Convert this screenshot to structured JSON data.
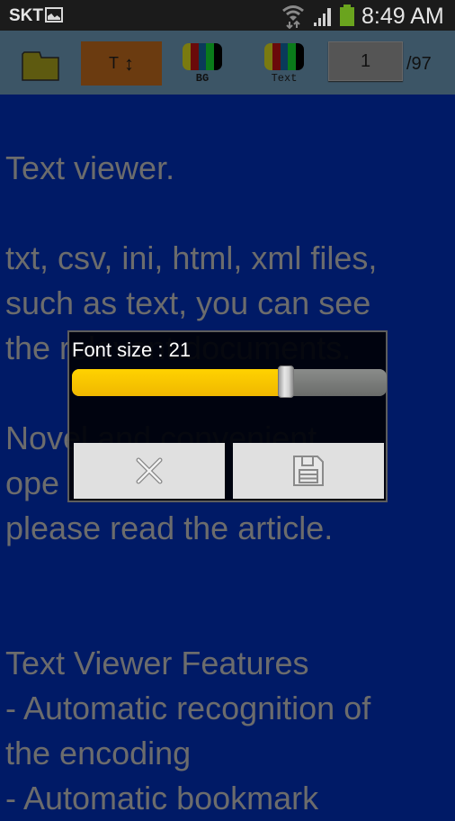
{
  "status_bar": {
    "carrier": "SKT",
    "time": "8:49 AM",
    "icons": [
      "gallery-notification-icon",
      "wifi-icon",
      "signal-icon",
      "battery-icon"
    ]
  },
  "toolbar": {
    "open_folder_icon": "folder-icon",
    "font_size_button": {
      "label": "T",
      "icon": "up-down-arrow-icon",
      "color": "#6b3b10"
    },
    "bg_color_button": {
      "label": "BG",
      "swatch_colors": [
        "#7a7a10",
        "#6a0a0a",
        "#0a3a5a",
        "#0a7a1a",
        "#000000"
      ]
    },
    "text_color_button": {
      "label": "Text",
      "swatch_colors": [
        "#7a7a10",
        "#6a0a0a",
        "#0a3a5a",
        "#0a7a1a",
        "#000000"
      ]
    },
    "page_input": {
      "value": "1"
    },
    "page_total": "/97"
  },
  "document": {
    "background_color": "#001a66",
    "text_color": "#6c6c6c",
    "lines": [
      "Text viewer.",
      "",
      "txt, csv, ini, html, xml files,",
      "such as text, you can see",
      "the relevant documents.",
      "",
      "Novel and convenient",
      "ope                              sy,",
      "please read the article.",
      "",
      "",
      "Text Viewer Features",
      "- Automatic recognition of",
      "the encoding",
      "- Automatic bookmark"
    ]
  },
  "font_size_dialog": {
    "title": "Font size : 21",
    "slider": {
      "fraction": 0.69,
      "fill_color": "#ffc800"
    },
    "cancel_icon": "close-icon",
    "save_icon": "floppy-disk-icon"
  }
}
